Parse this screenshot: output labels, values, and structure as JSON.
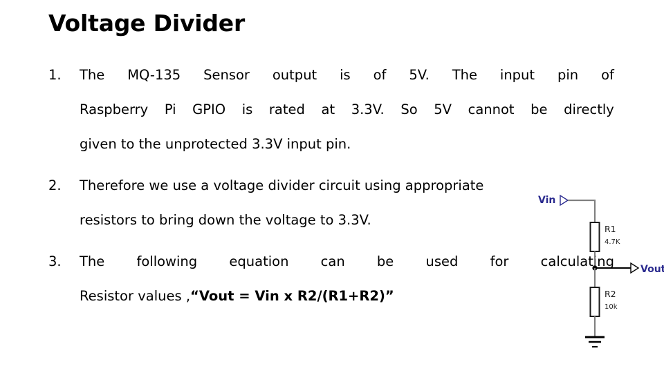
{
  "slide": {
    "title": "Voltage Divider",
    "background_color": "#ffffff",
    "text_color": "#000000"
  },
  "body": {
    "items": [
      {
        "marker": "1.",
        "lines": [
          [
            "The",
            "MQ-135",
            "Sensor",
            "output",
            "is",
            "of",
            "5V.",
            "The",
            "input",
            "pin",
            "of"
          ],
          [
            "Raspberry",
            "Pi",
            "GPIO",
            "is",
            "rated",
            "at",
            "3.3V.",
            "So",
            "5V",
            "cannot",
            "be",
            "directly"
          ],
          [
            "given to the unprotected 3.3V input pin."
          ]
        ],
        "text": "The MQ-135 Sensor output is of 5V. The input pin of Raspberry Pi GPIO is rated at 3.3V. So 5V cannot be directly given to the unprotected 3.3V input pin."
      },
      {
        "marker": "2.",
        "lines": [
          [
            "Therefore we use a voltage divider circuit using appropriate"
          ],
          [
            "resistors to bring down the voltage to 3.3V."
          ]
        ],
        "text": "Therefore we use a voltage divider circuit using appropriate resistors to bring down the voltage to 3.3V."
      },
      {
        "marker": "3.",
        "lines": [
          [
            "The",
            "following",
            "equation",
            "can",
            "be",
            "used",
            "for",
            "calculating"
          ]
        ],
        "text": "The following equation can be used for calculating Resistor values ,“Vout = Vin x R2/(R1+R2)”",
        "last_line_prefix": "Resistor values ,",
        "last_line_formula": "“Vout = Vin x R2/(R1+R2)”"
      }
    ]
  },
  "circuit": {
    "title": "voltage-divider-schematic",
    "wire_color": "#808080",
    "label_color": "#2b2b8f",
    "input_port": "Vin",
    "output_port": "Vout",
    "components": [
      {
        "ref": "R1",
        "value": "4.7K"
      },
      {
        "ref": "R2",
        "value": "10k"
      }
    ],
    "ground_symbol": "earth-ground"
  }
}
